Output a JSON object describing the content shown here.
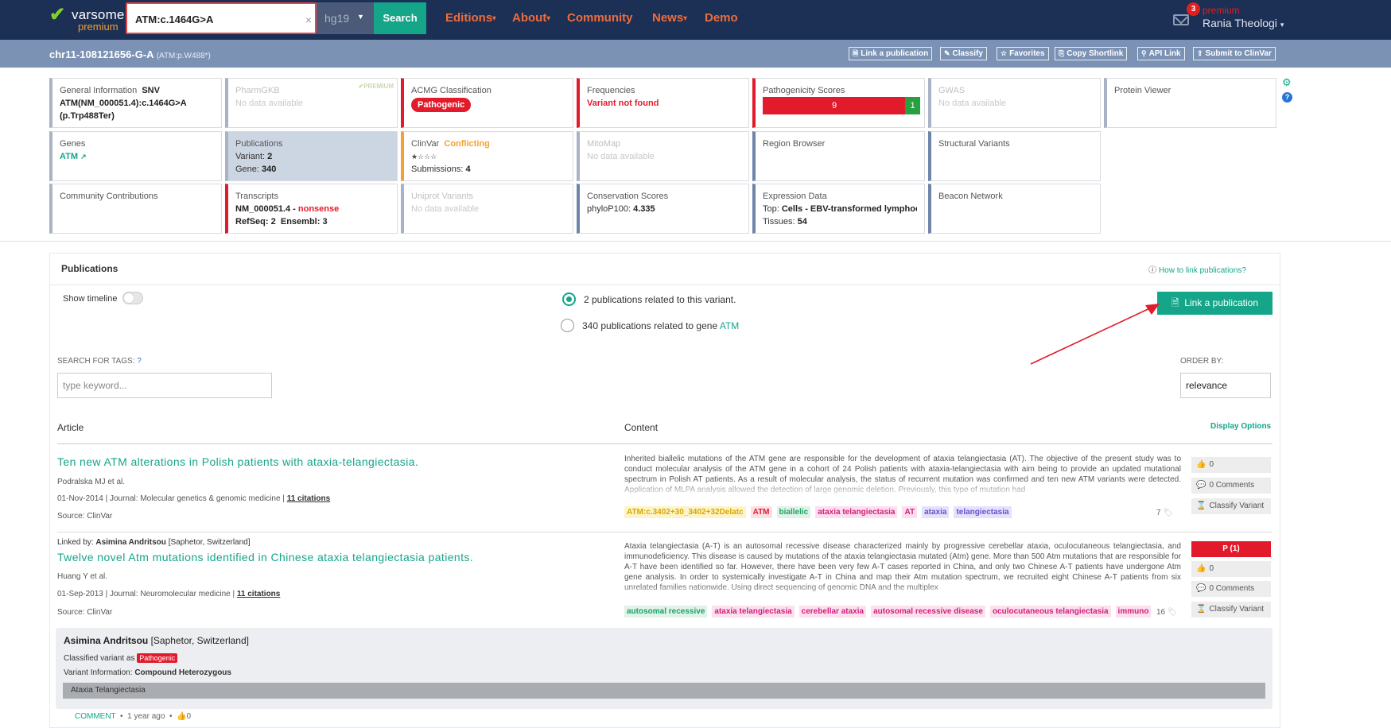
{
  "brand": {
    "name": "varsome",
    "tier": "premium",
    "colors": {
      "navy": "#1c2f55",
      "teal": "#15a589",
      "red": "#e21b2c",
      "orange": "#f06c3a"
    }
  },
  "search": {
    "value": "ATM:c.1464G>A",
    "clear_icon": "×",
    "genome": "hg19",
    "button": "Search"
  },
  "nav": [
    {
      "label": "Editions",
      "dropdown": true
    },
    {
      "label": "About",
      "dropdown": true
    },
    {
      "label": "Community",
      "dropdown": false
    },
    {
      "label": "News",
      "dropdown": true
    },
    {
      "label": "Demo",
      "dropdown": false
    }
  ],
  "user": {
    "notifications": "3",
    "plan": "premium",
    "name": "Rania Theologi"
  },
  "variant": {
    "title": "chr11-108121656-G-A",
    "subtitle": "(ATM:p.W488*)"
  },
  "toolbar": [
    {
      "label": "Link a publication",
      "icon": "doc-icon"
    },
    {
      "label": "Classify",
      "icon": "classify-icon"
    },
    {
      "label": "Favorites",
      "icon": "star-icon"
    },
    {
      "label": "Copy Shortlink",
      "icon": "copy-icon"
    },
    {
      "label": "API Link",
      "icon": "link-icon"
    },
    {
      "label": "Submit to ClinVar",
      "icon": "submit-icon"
    }
  ],
  "cards": {
    "general": {
      "title": "General Information",
      "type": "SNV",
      "line1": "ATM(NM_000051.4):c.1464G>A",
      "line2": "(p.Trp488Ter)"
    },
    "pharmgkb": {
      "title": "PharmGKB",
      "badge": "PREMIUM",
      "text": "No data available"
    },
    "acmg": {
      "title": "ACMG Classification",
      "value": "Pathogenic"
    },
    "frequencies": {
      "title": "Frequencies",
      "value": "Variant not found"
    },
    "pathogenicity": {
      "title": "Pathogenicity Scores",
      "pathogenic": "9",
      "benign": "1"
    },
    "gwas": {
      "title": "GWAS",
      "text": "No data available"
    },
    "protein": {
      "title": "Protein Viewer"
    },
    "genes": {
      "title": "Genes",
      "gene": "ATM"
    },
    "publications": {
      "title": "Publications",
      "variant_label": "Variant:",
      "variant_count": "2",
      "gene_label": "Gene:",
      "gene_count": "340"
    },
    "clinvar": {
      "title": "ClinVar",
      "status": "Conflicting",
      "stars": "★☆☆☆",
      "submissions_label": "Submissions:",
      "submissions": "4"
    },
    "mitomap": {
      "title": "MitoMap",
      "text": "No data available"
    },
    "region": {
      "title": "Region Browser"
    },
    "structural": {
      "title": "Structural Variants"
    },
    "community": {
      "title": "Community Contributions"
    },
    "transcripts": {
      "title": "Transcripts",
      "transcript": "NM_000051.4",
      "sep": " - ",
      "effect": "nonsense",
      "refseq_label": "RefSeq:",
      "refseq": "2",
      "ensembl_label": "Ensembl:",
      "ensembl": "3"
    },
    "uniprot": {
      "title": "Uniprot Variants",
      "text": "No data available"
    },
    "conservation": {
      "title": "Conservation Scores",
      "label": "phyloP100:",
      "value": "4.335"
    },
    "expression": {
      "title": "Expression Data",
      "top_label": "Top:",
      "top": "Cells - EBV-transformed lymphocy…",
      "tissues_label": "Tissues:",
      "tissues": "54"
    },
    "beacon": {
      "title": "Beacon Network"
    }
  },
  "publications": {
    "title": "Publications",
    "how_link": "How to link publications?",
    "show_timeline": "Show timeline",
    "radio1": "2 publications related to this variant.",
    "radio2_prefix": "340 publications related to gene",
    "radio2_gene": "ATM",
    "link_button": "Link a publication",
    "search_tags_label": "SEARCH FOR TAGS:",
    "search_placeholder": "type keyword...",
    "order_label": "ORDER BY:",
    "order_value": "relevance",
    "col_article": "Article",
    "col_content": "Content",
    "display_options": "Display Options",
    "articles": [
      {
        "linked_by": "",
        "title": "Ten new ATM alterations in Polish patients with ataxia-telangiectasia.",
        "authors": "Podralska MJ et al.",
        "date_journal": "01-Nov-2014 | Journal: Molecular genetics & genomic medicine |",
        "citations": "11 citations",
        "source": "Source: ClinVar",
        "content": "Inherited biallelic mutations of the ATM gene are responsible for the development of ataxia telangiectasia (AT). The objective of the present study was to conduct molecular analysis of the ATM gene in a cohort of 24 Polish patients with ataxia-telangiectasia with aim being to provide an updated mutational spectrum in Polish AT patients. As a result of molecular analysis, the status of recurrent mutation was confirmed and ten new ATM variants were detected. Application of MLPA analysis allowed the detection of large genomic deletion. Previously, this type of mutation had",
        "tags": [
          {
            "t": "ATM:c.3402+30_3402+32Delatc",
            "bg": "#fdf5c9",
            "c": "#d8a600"
          },
          {
            "t": "ATM",
            "bg": "#fde0e6",
            "c": "#e21b2c"
          },
          {
            "t": "biallelic",
            "bg": "#dff3ea",
            "c": "#20a060"
          },
          {
            "t": "ataxia telangiectasia",
            "bg": "#fde0ef",
            "c": "#d0207a"
          },
          {
            "t": "AT",
            "bg": "#fde0ef",
            "c": "#d0207a"
          },
          {
            "t": "ataxia",
            "bg": "#e5e2fb",
            "c": "#6650d0"
          },
          {
            "t": "telangiectasia",
            "bg": "#e5e2fb",
            "c": "#6650d0"
          }
        ],
        "tag_count": "7",
        "likes": "0",
        "comments": "0 Comments",
        "classify": "Classify Variant",
        "classification": ""
      },
      {
        "linked_by_label": "Linked by:",
        "linked_by": "Asimina Andritsou",
        "linked_org": "[Saphetor, Switzerland]",
        "title": "Twelve novel Atm mutations identified in Chinese ataxia telangiectasia patients.",
        "authors": "Huang Y et al.",
        "date_journal": "01-Sep-2013 | Journal: Neuromolecular medicine |",
        "citations": "11 citations",
        "source": "Source: ClinVar",
        "content": "Ataxia telangiectasia (A-T) is an autosomal recessive disease characterized mainly by progressive cerebellar ataxia, oculocutaneous telangiectasia, and immunodeficiency. This disease is caused by mutations of the ataxia telangiectasia mutated (Atm) gene. More than 500 Atm mutations that are responsible for A-T have been identified so far. However, there have been very few A-T cases reported in China, and only two Chinese A-T patients have undergone Atm gene analysis. In order to systemically investigate A-T in China and map their Atm mutation spectrum, we recruited eight Chinese A-T patients from six unrelated families nationwide. Using direct sequencing of genomic DNA and the multiplex",
        "tags": [
          {
            "t": "autosomal recessive",
            "bg": "#dff3ea",
            "c": "#20a060"
          },
          {
            "t": "ataxia telangiectasia",
            "bg": "#fde0ef",
            "c": "#d0207a"
          },
          {
            "t": "cerebellar ataxia",
            "bg": "#fde0ef",
            "c": "#d0207a"
          },
          {
            "t": "autosomal recessive disease",
            "bg": "#fde0ef",
            "c": "#d0207a"
          },
          {
            "t": "oculocutaneous telangiectasia",
            "bg": "#fde0ef",
            "c": "#d0207a"
          },
          {
            "t": "immuno",
            "bg": "#fde0ef",
            "c": "#d0207a"
          }
        ],
        "tag_count": "16",
        "likes": "0",
        "comments": "0 Comments",
        "classify": "Classify Variant",
        "classification": "P (1)"
      }
    ],
    "comment": {
      "author": "Asimina Andritsou",
      "org": "[Saphetor, Switzerland]",
      "classified_label": "Classified variant as",
      "classified_value": "Pathogenic",
      "variant_info_label": "Variant Information:",
      "variant_info_value": "Compound Heterozygous",
      "disease": "Ataxia Telangiectasia",
      "action": "COMMENT",
      "sep": "•",
      "time": "1 year ago",
      "likes": "0"
    }
  }
}
